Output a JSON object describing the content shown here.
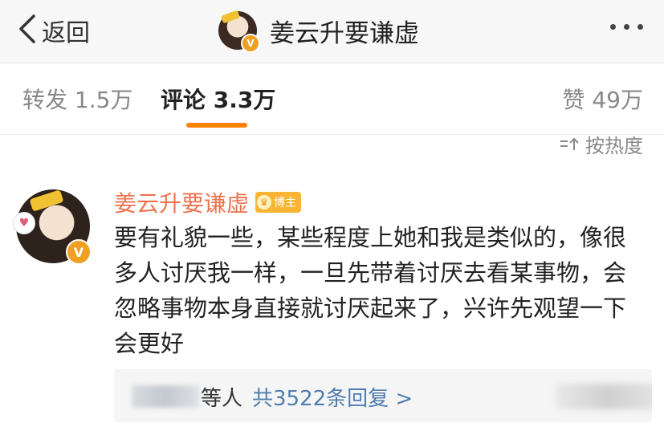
{
  "nav": {
    "back_label": "返回",
    "title": "姜云升要谦虚",
    "verified_badge": "V"
  },
  "tabs": [
    {
      "label": "转发 1.5万",
      "active": false
    },
    {
      "label": "评论 3.3万",
      "active": true
    },
    {
      "label": "赞 49万",
      "active": false
    }
  ],
  "sort": {
    "label": "按热度"
  },
  "comment": {
    "author": "姜云升要谦虚",
    "badge": "博主",
    "text": "要有礼貌一些，某些程度上她和我是类似的，像很多人讨厌我一样，一旦先带着讨厌去看某事物，会忽略事物本身直接就讨厌起来了，兴许先观望一下会更好",
    "replies": {
      "who": "等人",
      "count_label": "共3522条回复 >"
    }
  },
  "colors": {
    "accent": "#ff8200",
    "author_name": "#eb7350",
    "link": "#507daf",
    "badge": "#f7b533"
  }
}
